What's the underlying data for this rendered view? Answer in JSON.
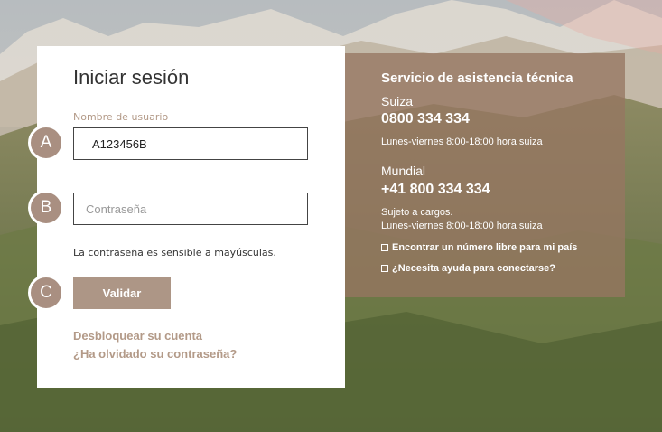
{
  "login": {
    "title": "Iniciar sesión",
    "username_label": "Nombre de usuario",
    "username_value": "A123456B",
    "password_placeholder": "Contraseña",
    "case_note": "La contraseña es sensible a mayúsculas.",
    "submit_label": "Validar",
    "unlock_link": "Desbloquear su cuenta",
    "forgot_link": "¿Ha olvidado su contraseña?"
  },
  "markers": {
    "a": "A",
    "b": "B",
    "c": "C"
  },
  "support": {
    "title": "Servicio de asistencia técnica",
    "swiss_region": "Suiza",
    "swiss_phone": "0800 334 334",
    "swiss_hours": "Lunes-viernes 8:00-18:00 hora suiza",
    "world_region": "Mundial",
    "world_phone": "+41 800 334 334",
    "world_note": "Sujeto a cargos.",
    "world_hours": "Lunes-viernes 8:00-18:00 hora suiza",
    "link_free_number": "Encontrar un número libre para mi país",
    "link_help_connect": "¿Necesita ayuda para conectarse?",
    "link_icon": "external-link-icon"
  },
  "colors": {
    "accent": "#ad9686",
    "accent_text": "#b39a88",
    "panel_bg": "#96765e",
    "marker_bg": "#a98f81"
  }
}
